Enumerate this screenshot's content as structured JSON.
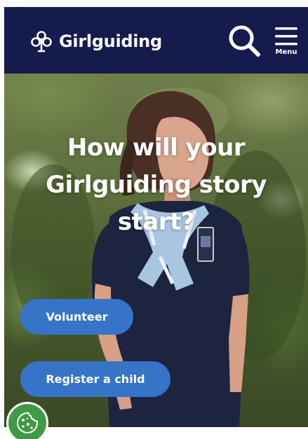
{
  "header": {
    "brand_name": "Girlguiding",
    "menu_label": "Menu",
    "search_icon": "search-icon",
    "menu_icon": "hamburger-icon",
    "logo_icon": "trefoil-icon",
    "background_color": "#161b4e"
  },
  "hero": {
    "title_lines": [
      "How will your",
      "Girlguiding story",
      "start?"
    ],
    "buttons": {
      "volunteer_label": "Volunteer",
      "register_label": "Register a child"
    },
    "button_color": "#3674c8"
  },
  "cookie": {
    "icon": "cookie-icon",
    "color": "#3f9a46"
  }
}
